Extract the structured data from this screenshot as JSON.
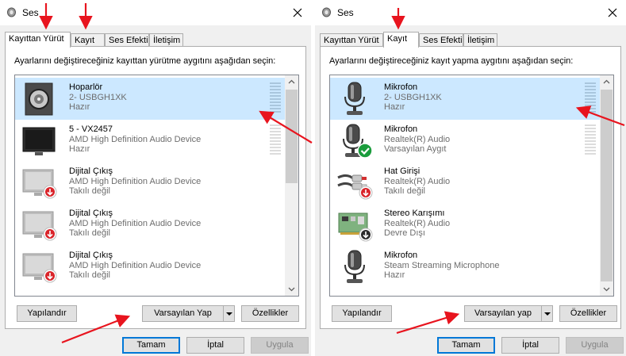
{
  "dialogs": [
    {
      "id": "left",
      "title": "Ses",
      "tabs": [
        {
          "label": "Kayıttan Yürüt",
          "active": true
        },
        {
          "label": "Kayıt",
          "active": false
        },
        {
          "label": "Ses Efekti",
          "active": false
        },
        {
          "label": "İletişim",
          "active": false
        }
      ],
      "instruction": "Ayarlarını değiştireceğiniz kayıttan yürütme aygıtını aşağıdan seçin:",
      "devices": [
        {
          "name": "Hoparlör",
          "sub": "2- USBGH1XK",
          "status": "Hazır",
          "icon": "speaker-icon",
          "selected": true,
          "meter": true
        },
        {
          "name": "5 - VX2457",
          "sub": "AMD High Definition Audio Device",
          "status": "Hazır",
          "icon": "monitor-icon",
          "selected": false,
          "meter": true
        },
        {
          "name": "Dijital Çıkış",
          "sub": "AMD High Definition Audio Device",
          "status": "Takılı değil",
          "icon": "monitor-unplugged-icon",
          "selected": false,
          "meter": false
        },
        {
          "name": "Dijital Çıkış",
          "sub": "AMD High Definition Audio Device",
          "status": "Takılı değil",
          "icon": "monitor-unplugged-icon",
          "selected": false,
          "meter": false
        },
        {
          "name": "Dijital Çıkış",
          "sub": "AMD High Definition Audio Device",
          "status": "Takılı değil",
          "icon": "monitor-unplugged-icon",
          "selected": false,
          "meter": false
        }
      ],
      "buttons": {
        "configure": "Yapılandır",
        "set_default": "Varsayılan Yap",
        "properties": "Özellikler",
        "ok": "Tamam",
        "cancel": "İptal",
        "apply": "Uygula"
      }
    },
    {
      "id": "right",
      "title": "Ses",
      "tabs": [
        {
          "label": "Kayıttan Yürüt",
          "active": false
        },
        {
          "label": "Kayıt",
          "active": true
        },
        {
          "label": "Ses Efekti",
          "active": false
        },
        {
          "label": "İletişim",
          "active": false
        }
      ],
      "instruction": "Ayarlarını değiştireceğiniz kayıt yapma aygıtını aşağıdan seçin:",
      "devices": [
        {
          "name": "Mikrofon",
          "sub": "2- USBGH1XK",
          "status": "Hazır",
          "icon": "microphone-icon",
          "selected": true,
          "meter": true
        },
        {
          "name": "Mikrofon",
          "sub": "Realtek(R) Audio",
          "status": "Varsayılan Aygıt",
          "icon": "microphone-default-icon",
          "selected": false,
          "meter": true
        },
        {
          "name": "Hat Girişi",
          "sub": "Realtek(R) Audio",
          "status": "Takılı değil",
          "icon": "line-in-icon",
          "selected": false,
          "meter": false
        },
        {
          "name": "Stereo Karışımı",
          "sub": "Realtek(R) Audio",
          "status": "Devre Dışı",
          "icon": "sound-card-disabled-icon",
          "selected": false,
          "meter": false
        },
        {
          "name": "Mikrofon",
          "sub": "Steam Streaming Microphone",
          "status": "Hazır",
          "icon": "microphone-icon",
          "selected": false,
          "meter": false
        }
      ],
      "buttons": {
        "configure": "Yapılandır",
        "set_default": "Varsayılan yap",
        "properties": "Özellikler",
        "ok": "Tamam",
        "cancel": "İptal",
        "apply": "Uygula"
      }
    }
  ],
  "colors": {
    "selection": "#cce8ff",
    "annotation_red": "#e8141e",
    "primary_border": "#0078d7",
    "meter": "#a9c6dd",
    "default_check": "#1a9c3c",
    "unplugged_badge": "#d9242a"
  }
}
